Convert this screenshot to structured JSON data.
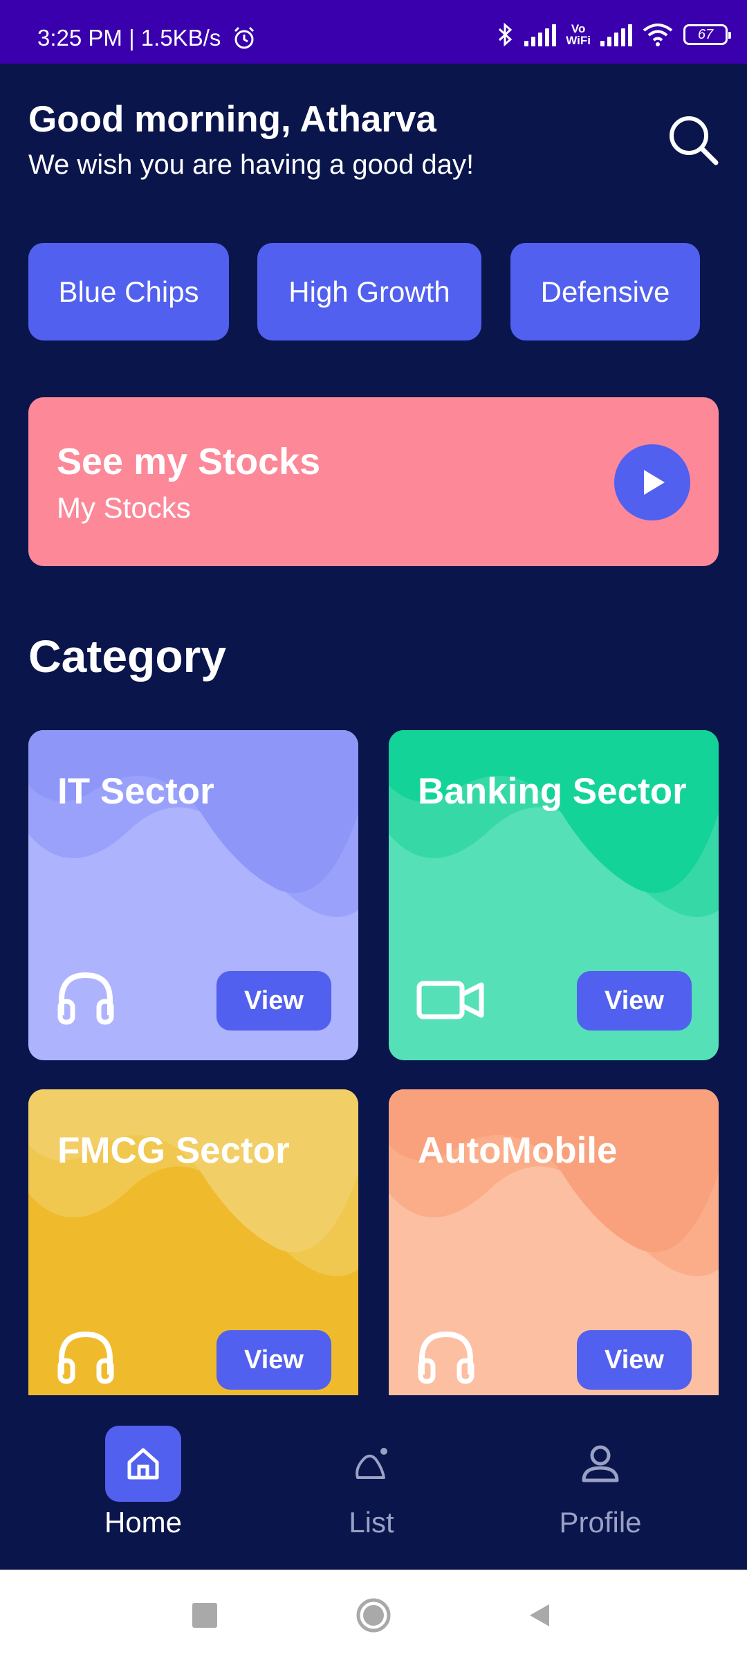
{
  "status_bar": {
    "time": "3:25 PM | 1.5KB/s",
    "vowifi_top": "Vo",
    "vowifi_bottom": "WiFi",
    "battery": "67"
  },
  "header": {
    "greeting": "Good morning, Atharva",
    "subtitle": "We wish you are having a good day!"
  },
  "chips": [
    "Blue Chips",
    "High Growth",
    "Defensive"
  ],
  "my_stocks": {
    "title": "See my Stocks",
    "subtitle": "My Stocks"
  },
  "category": {
    "title": "Category",
    "cards": [
      {
        "title": "IT Sector",
        "button": "View",
        "icon": "headphones-icon",
        "color": "#aeb3fd"
      },
      {
        "title": "Banking Sector",
        "button": "View",
        "icon": "video-camera-icon",
        "color": "#55e0b7"
      },
      {
        "title": "FMCG Sector",
        "button": "View",
        "icon": "headphones-icon",
        "color": "#efbb2d"
      },
      {
        "title": "AutoMobile",
        "button": "View",
        "icon": "headphones-icon",
        "color": "#fcbfa2"
      }
    ]
  },
  "bottom_nav": {
    "items": [
      {
        "label": "Home",
        "icon": "home-icon",
        "active": true
      },
      {
        "label": "List",
        "icon": "list-icon",
        "active": false
      },
      {
        "label": "Profile",
        "icon": "profile-icon",
        "active": false
      }
    ]
  },
  "colors": {
    "background": "#0a154b",
    "status_bar": "#3a00ae",
    "accent": "#5160ee",
    "banner": "#fc8898"
  }
}
